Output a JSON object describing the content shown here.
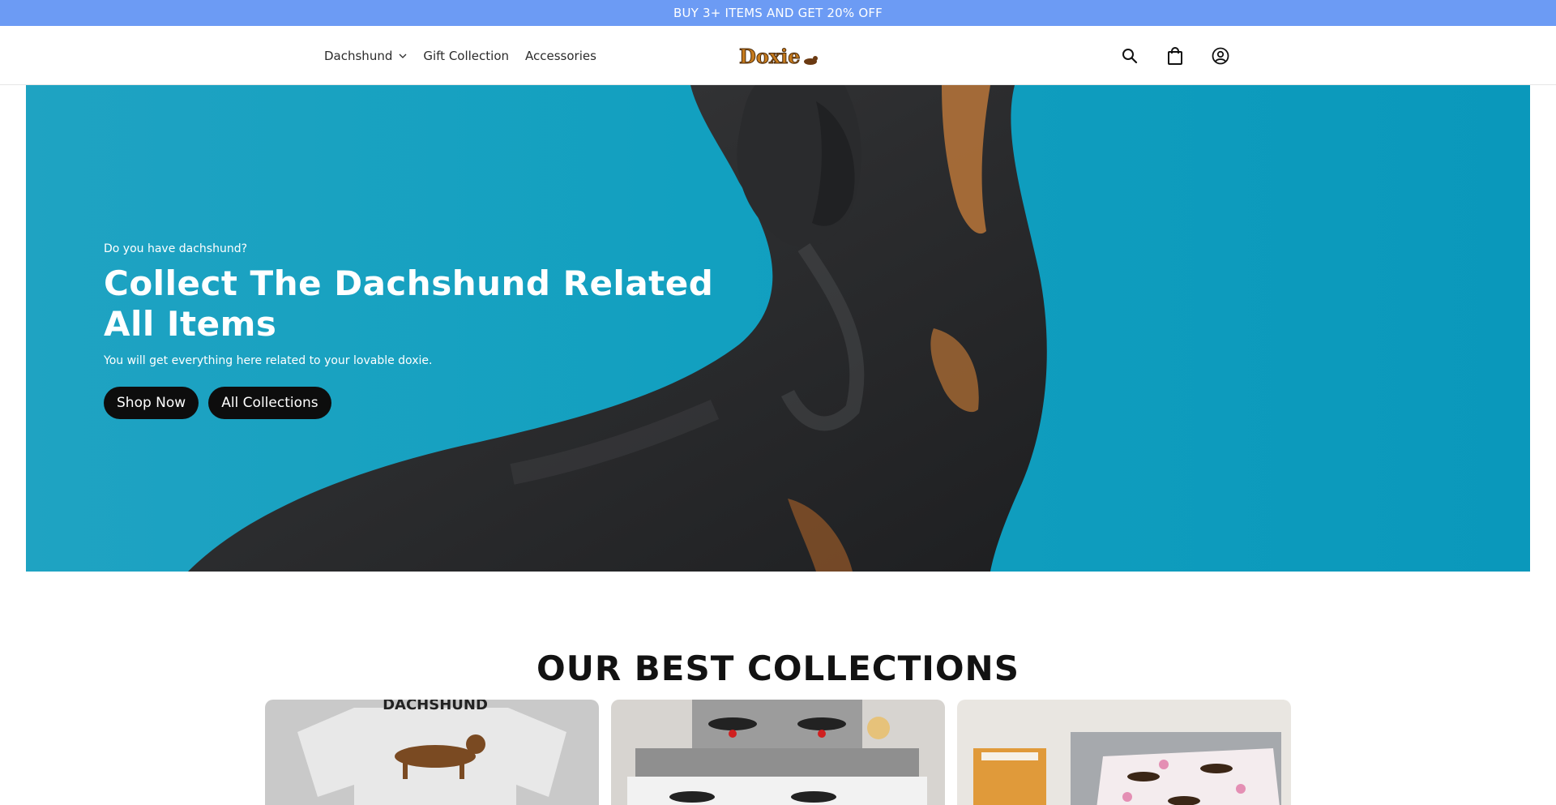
{
  "announcement": {
    "text": "BUY 3+ ITEMS AND GET 20% OFF"
  },
  "nav": {
    "items": [
      {
        "label": "Dachshund",
        "has_dropdown": true
      },
      {
        "label": "Gift Collection"
      },
      {
        "label": "Accessories"
      }
    ]
  },
  "logo": {
    "alt": "Doxie"
  },
  "header_icons": [
    "search-icon",
    "cart-icon",
    "account-icon"
  ],
  "hero": {
    "subheading": "Do you have dachshund?",
    "title": "Collect The Dachshund Related All Items",
    "description": "You will get everything here related to your lovable doxie.",
    "buttons": [
      {
        "label": "Shop Now"
      },
      {
        "label": "All Collections"
      }
    ]
  },
  "best_collections": {
    "title": "OUR BEST COLLECTIONS",
    "cards": [
      {
        "image_text": "DACHSHUND"
      },
      {
        "image_text": ""
      },
      {
        "image_text": ""
      }
    ]
  },
  "colors": {
    "announcement_bg": "#6c9bf4",
    "hero_bg": "#12a0c0",
    "button_bg": "#0d0d0d"
  }
}
